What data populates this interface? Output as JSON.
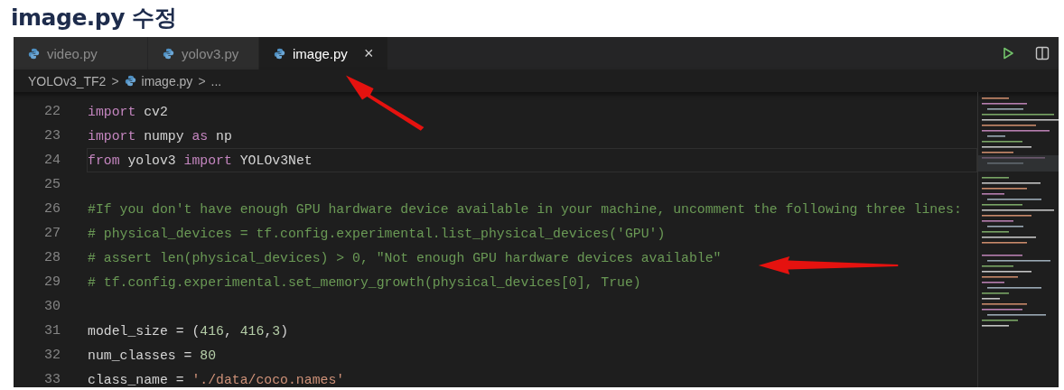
{
  "heading": "image.py 수정",
  "tabs": [
    {
      "label": "video.py",
      "selected": false
    },
    {
      "label": "yolov3.py",
      "selected": false
    },
    {
      "label": "image.py",
      "selected": true,
      "close": "×"
    }
  ],
  "breadcrumb": {
    "folder": "YOLOv3_TF2",
    "separator": ">",
    "file": "image.py",
    "more": "..."
  },
  "code_lines": [
    {
      "number": "22",
      "current": false,
      "tokens": [
        {
          "kind": "keyword",
          "text": "import"
        },
        {
          "kind": "plain",
          "text": " cv2"
        }
      ]
    },
    {
      "number": "23",
      "current": false,
      "tokens": [
        {
          "kind": "keyword",
          "text": "import"
        },
        {
          "kind": "plain",
          "text": " numpy "
        },
        {
          "kind": "keyword",
          "text": "as"
        },
        {
          "kind": "plain",
          "text": " np"
        }
      ]
    },
    {
      "number": "24",
      "current": true,
      "tokens": [
        {
          "kind": "keyword",
          "text": "from"
        },
        {
          "kind": "plain",
          "text": " yolov3 "
        },
        {
          "kind": "keyword",
          "text": "import"
        },
        {
          "kind": "plain",
          "text": " YOLOv3Net"
        }
      ]
    },
    {
      "number": "25",
      "current": false
    },
    {
      "number": "26",
      "current": false,
      "tokens": [
        {
          "kind": "comment",
          "text": "#If you don't have enough GPU hardware device available in your machine, uncomment the following three lines:"
        }
      ]
    },
    {
      "number": "27",
      "current": false,
      "tokens": [
        {
          "kind": "comment",
          "text": "# physical_devices = tf.config.experimental.list_physical_devices('GPU')"
        }
      ]
    },
    {
      "number": "28",
      "current": false,
      "tokens": [
        {
          "kind": "comment",
          "text": "# assert len(physical_devices) > 0, \"Not enough GPU hardware devices available\""
        }
      ]
    },
    {
      "number": "29",
      "current": false,
      "tokens": [
        {
          "kind": "comment",
          "text": "# tf.config.experimental.set_memory_growth(physical_devices[0], True)"
        }
      ]
    },
    {
      "number": "30",
      "current": false
    },
    {
      "number": "31",
      "current": false,
      "tokens": [
        {
          "kind": "plain",
          "text": "model_size = ("
        },
        {
          "kind": "number",
          "text": "416"
        },
        {
          "kind": "plain",
          "text": ", "
        },
        {
          "kind": "number",
          "text": "416"
        },
        {
          "kind": "plain",
          "text": ","
        },
        {
          "kind": "number",
          "text": "3"
        },
        {
          "kind": "plain",
          "text": ")"
        }
      ]
    },
    {
      "number": "32",
      "current": false,
      "tokens": [
        {
          "kind": "plain",
          "text": "num_classes = "
        },
        {
          "kind": "number",
          "text": "80"
        }
      ]
    },
    {
      "number": "33",
      "current": false,
      "tokens": [
        {
          "kind": "plain",
          "text": "class_name = "
        },
        {
          "kind": "string",
          "text": "'./data/coco.names'"
        }
      ]
    }
  ]
}
